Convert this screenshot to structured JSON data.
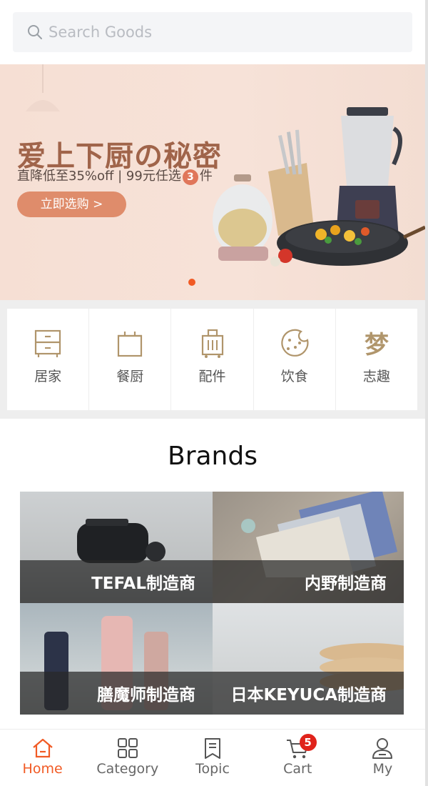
{
  "search": {
    "placeholder": "Search Goods"
  },
  "banner": {
    "title": "爱上下厨の秘密",
    "subtitle_pre": "直降低至35%off | 99元任选",
    "subtitle_num": "3",
    "subtitle_post": "件",
    "button": "立即选购 >"
  },
  "categories": [
    {
      "label": "居家",
      "icon": "cabinet-icon"
    },
    {
      "label": "餐厨",
      "icon": "pot-icon"
    },
    {
      "label": "配件",
      "icon": "luggage-icon"
    },
    {
      "label": "饮食",
      "icon": "cookie-icon"
    },
    {
      "label": "志趣",
      "icon": "meng-char-icon"
    }
  ],
  "brands": {
    "title": "Brands",
    "items": [
      {
        "name": "TEFAL制造商"
      },
      {
        "name": "内野制造商"
      },
      {
        "name": "膳魔师制造商"
      },
      {
        "name": "日本KEYUCA制造商"
      }
    ]
  },
  "tabbar": {
    "items": [
      {
        "label": "Home",
        "active": true
      },
      {
        "label": "Category"
      },
      {
        "label": "Topic"
      },
      {
        "label": "Cart",
        "badge": "5"
      },
      {
        "label": "My"
      }
    ]
  },
  "colors": {
    "accent": "#f15a24",
    "badge": "#e0231b",
    "icon_gold": "#b0956b"
  }
}
